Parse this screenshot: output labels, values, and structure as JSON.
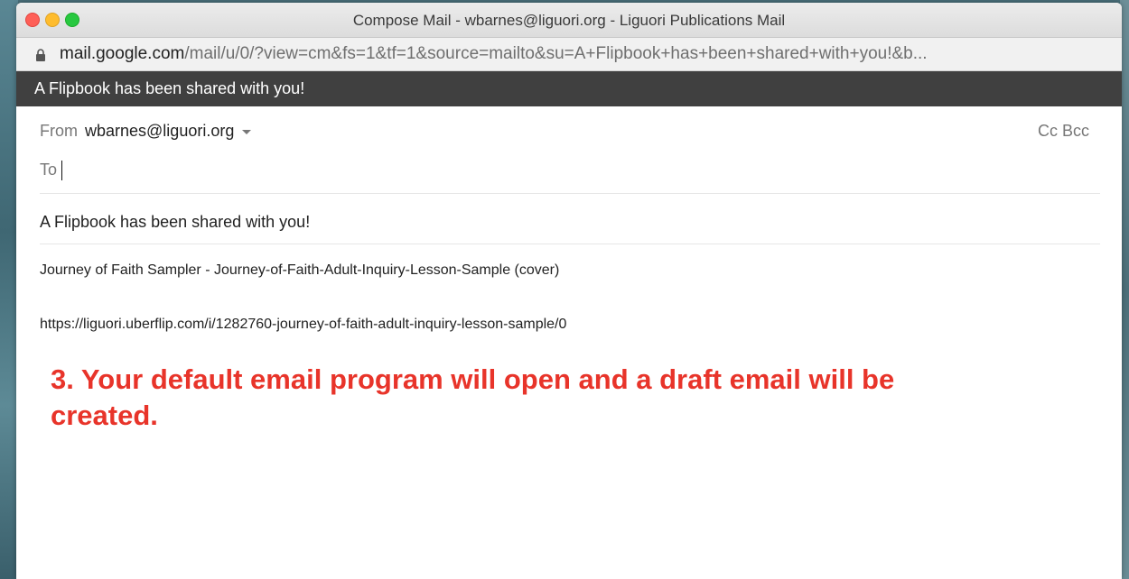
{
  "window": {
    "title": "Compose Mail - wbarnes@liguori.org - Liguori Publications Mail"
  },
  "address_bar": {
    "domain": "mail.google.com",
    "path": "/mail/u/0/?view=cm&fs=1&tf=1&source=mailto&su=A+Flipbook+has+been+shared+with+you!&b..."
  },
  "header": {
    "subject_title": "A Flipbook has been shared with you!"
  },
  "compose": {
    "from_label": "From",
    "from_value": "wbarnes@liguori.org",
    "cc_bcc_label": "Cc Bcc",
    "to_label": "To",
    "subject": "A Flipbook has been shared with you!",
    "body_lines": [
      "Journey of Faith Sampler - Journey-of-Faith-Adult-Inquiry-Lesson-Sample (cover)",
      "https://liguori.uberflip.com/i/1282760-journey-of-faith-adult-inquiry-lesson-sample/0"
    ]
  },
  "annotation": {
    "text": "3. Your default email program will open and a draft email will be created."
  },
  "colors": {
    "header_bar": "#404040",
    "annotation": "#e8342a"
  },
  "icons": [
    "lock-icon",
    "chevron-down-icon"
  ]
}
